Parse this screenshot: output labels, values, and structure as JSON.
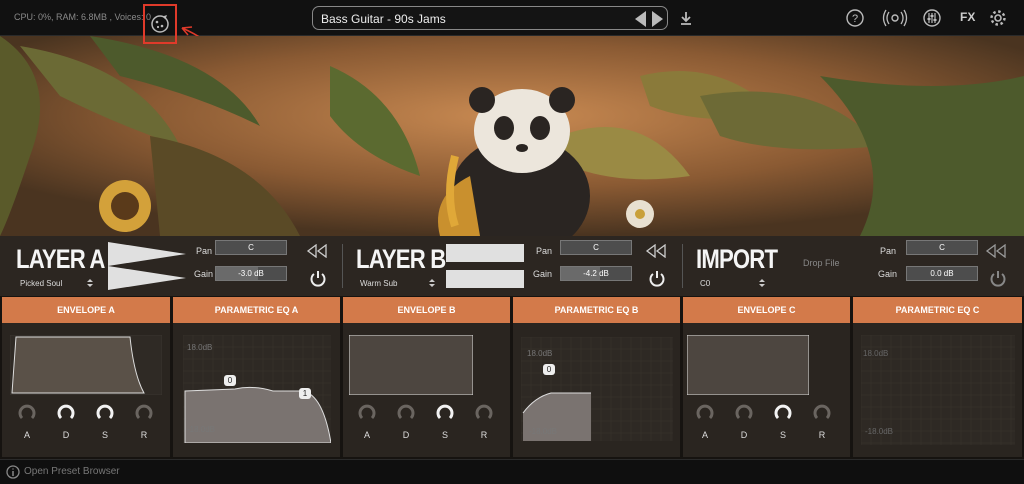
{
  "topbar": {
    "status": "CPU: 0%, RAM: 6.8MB , Voices: 0",
    "preset_name": "Bass Guitar - 90s Jams",
    "fx_label": "FX"
  },
  "layers": {
    "a": {
      "title": "LAYER A",
      "sub": "Picked Soul",
      "pan_label": "Pan",
      "pan": "C",
      "gain_label": "Gain",
      "gain": "-3.0 dB",
      "gain_fill": 0.6
    },
    "b": {
      "title": "LAYER B",
      "sub": "Warm Sub",
      "pan_label": "Pan",
      "pan": "C",
      "gain_label": "Gain",
      "gain": "-4.2 dB",
      "gain_fill": 0.55
    },
    "c": {
      "title": "IMPORT",
      "sub": "C0",
      "pan_label": "Pan",
      "pan": "C",
      "gain_label": "Gain",
      "gain": "0.0 dB",
      "gain_fill": 0.0,
      "drop": "Drop File"
    }
  },
  "sections": {
    "env_a": "ENVELOPE A",
    "eq_a": "PARAMETRIC EQ A",
    "env_b": "ENVELOPE B",
    "eq_b": "PARAMETRIC EQ B",
    "env_c": "ENVELOPE C",
    "eq_c": "PARAMETRIC EQ C"
  },
  "eq": {
    "db_top": "18.0dB",
    "db_bottom": "-18.0dB",
    "node0": "0",
    "node1": "1"
  },
  "knobs": {
    "a": "A",
    "d": "D",
    "s": "S",
    "r": "R"
  },
  "bottom": {
    "browser": "Open Preset Browser"
  },
  "colors": {
    "accent": "#d37a4a",
    "annotation": "#e03a2a"
  }
}
